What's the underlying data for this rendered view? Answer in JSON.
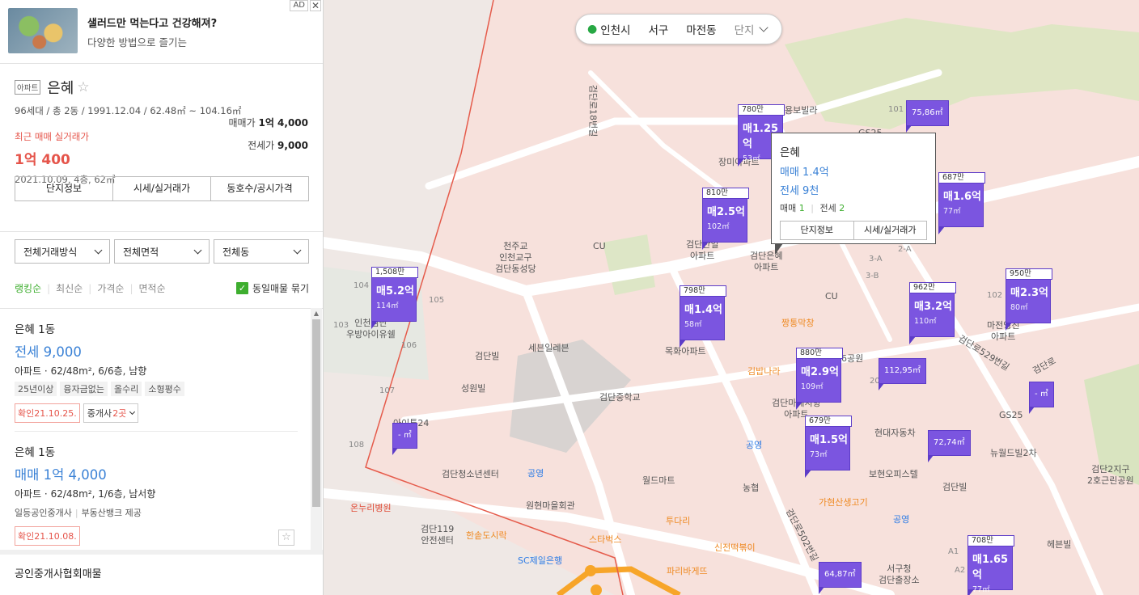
{
  "ad": {
    "title": "샐러드만 먹는다고 건강해져?",
    "subtitle": "다양한 방법으로 즐기는",
    "badge": "AD",
    "close": "✕"
  },
  "complex": {
    "type_tag": "아파트",
    "name": "은혜",
    "info": "96세대 / 총 2동 / 1991.12.04 / 62.48㎡ ~ 104.16㎡",
    "recent_label": "최근 매매 실거래가",
    "recent_price": "1억 400",
    "recent_date": "2021.10.09, 4층, 62㎡",
    "sale_label": "매매가",
    "sale_value": "1억 4,000",
    "rent_label": "전세가",
    "rent_value": "9,000",
    "tabs": [
      "단지정보",
      "시세/실거래가",
      "동호수/공시가격"
    ]
  },
  "filters": [
    "전체거래방식",
    "전체면적",
    "전체동"
  ],
  "sort": {
    "options": [
      "랭킹순",
      "최신순",
      "가격순",
      "면적순"
    ],
    "merge_label": "동일매물 묶기"
  },
  "listings": [
    {
      "name": "은혜 1동",
      "price": "전세 9,000",
      "desc": "아파트 · 62/48m², 6/6층, 남향",
      "tags": [
        "25년이상",
        "융자금없는",
        "올수리",
        "소형평수"
      ],
      "confirm": "확인21.10.25.",
      "agents_prefix": "중개사 ",
      "agents_count": "2곳"
    },
    {
      "name": "은혜 1동",
      "price": "매매 1억 4,000",
      "desc": "아파트 · 62/48m², 1/6층, 남서향",
      "provider1": "일등공인중개사",
      "provider2": "부동산뱅크 제공",
      "confirm": "확인21.10.08."
    }
  ],
  "association_label": "공인중개사협회매물",
  "map": {
    "location": [
      "인천시",
      "서구",
      "마전동",
      "단지"
    ],
    "popup": {
      "name": "은혜",
      "sale": "매매 1.4억",
      "rent": "전세 9천",
      "sale_count_label": "매매",
      "sale_count": "1",
      "rent_count_label": "전세",
      "rent_count": "2",
      "buttons": [
        "단지정보",
        "시세/실거래가"
      ]
    },
    "markers": [
      {
        "top": "780만",
        "price": "매1.25억",
        "area": "53㎡"
      },
      {
        "top": "687만",
        "price": "매1.6억",
        "area": "77㎡"
      },
      {
        "top": "810만",
        "price": "매2.5억",
        "area": "102㎡"
      },
      {
        "top": "1,508만",
        "price": "매5.2억",
        "area": "114㎡"
      },
      {
        "top": "798만",
        "price": "매1.4억",
        "area": "58㎡"
      },
      {
        "top": "962만",
        "price": "매3.2억",
        "area": "110㎡"
      },
      {
        "top": "950만",
        "price": "매2.3억",
        "area": "80㎡"
      },
      {
        "top": "880만",
        "price": "매2.9억",
        "area": "109㎡"
      },
      {
        "top": "679만",
        "price": "매1.5억",
        "area": "73㎡"
      },
      {
        "top": "708만",
        "price": "매1.65억",
        "area": "77㎡"
      }
    ],
    "mini_markers": [
      "75,86㎡",
      "112,95㎡",
      "- ㎡",
      "72,74㎡",
      "- ㎡",
      "64,87㎡"
    ],
    "pois": [
      "천주교\n인천교구\n검단동성당",
      "CU",
      "장미아파트",
      "검단한일\n아파트",
      "검단은혜\n아파트",
      "CU",
      "짱통막창",
      "목화아파트",
      "세븐일레븐",
      "검단빌",
      "성원빌",
      "검단중학교",
      "김밥나라",
      "검단마레지향\n아파트",
      "공영",
      "현대자동차",
      "월드마트",
      "농협",
      "뉴월드빌2차",
      "보현오피스텔",
      "검단빌",
      "가현산생고기",
      "공영",
      "투다리",
      "신전떡볶이",
      "스타벅스",
      "원현마을회관",
      "공영",
      "검단청소년센터",
      "온누리병원",
      "검단119\n안전센터",
      "한솥도시락",
      "SC제일은행",
      "파리바게뜨",
      "서구청\n검단출장소",
      "헤븐빌",
      "검단2지구\n2호근린공원",
      "마전영진\n아파트",
      "GS25",
      "인천검단\n우방아이유쉘",
      "검단로529번길",
      "검단로502번길",
      "검단로",
      "검단로18번길",
      "아이투24",
      "GS25",
      "용보빌라",
      "6공원"
    ]
  }
}
